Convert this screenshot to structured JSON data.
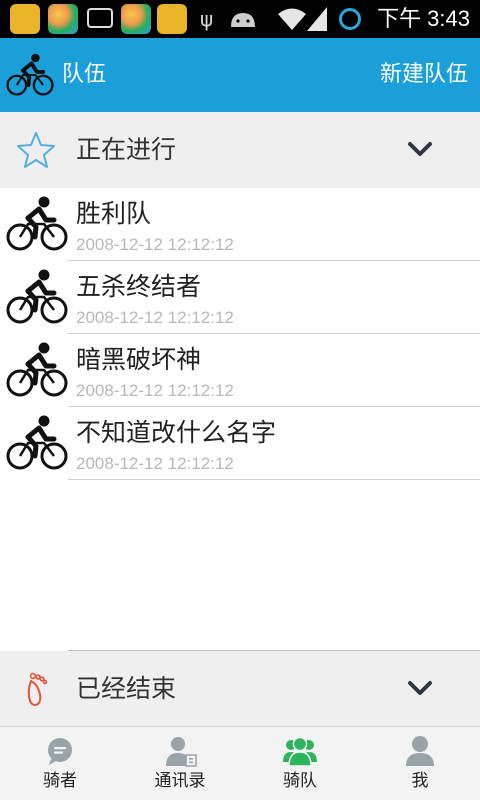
{
  "status_bar": {
    "clock": "下午 3:43",
    "icons": [
      "app-icon",
      "ball-app-icon",
      "message-icon",
      "ball-app-icon",
      "app-icon",
      "usb-icon",
      "android-icon",
      "wifi-icon",
      "signal-icon",
      "battery-icon",
      "sync-ring-icon"
    ]
  },
  "title_bar": {
    "title": "队伍",
    "action": "新建队伍",
    "background": "#1a9fd9"
  },
  "sections": {
    "ongoing": {
      "label": "正在进行",
      "icon": "star-icon"
    },
    "ended": {
      "label": "已经结束",
      "icon": "footprint-icon"
    }
  },
  "teams": [
    {
      "name": "胜利队",
      "time": "2008-12-12 12:12:12",
      "icon": "bicycle-icon"
    },
    {
      "name": "五杀终结者",
      "time": "2008-12-12 12:12:12",
      "icon": "bicycle-icon"
    },
    {
      "name": "暗黑破坏神",
      "time": "2008-12-12 12:12:12",
      "icon": "bicycle-icon"
    },
    {
      "name": "不知道改什么名字",
      "time": "2008-12-12 12:12:12",
      "icon": "bicycle-icon"
    }
  ],
  "tabs": [
    {
      "label": "骑者",
      "icon": "chat-bubble-icon",
      "active": false
    },
    {
      "label": "通讯录",
      "icon": "contacts-icon",
      "active": false
    },
    {
      "label": "骑队",
      "icon": "group-icon",
      "active": true
    },
    {
      "label": "我",
      "icon": "person-icon",
      "active": false
    }
  ],
  "colors": {
    "accent": "#1a9fd9",
    "tab_active": "#2db55d",
    "tab_inactive": "#9aa3a8",
    "star_outline": "#55aee0",
    "footprint": "#e8533b"
  }
}
